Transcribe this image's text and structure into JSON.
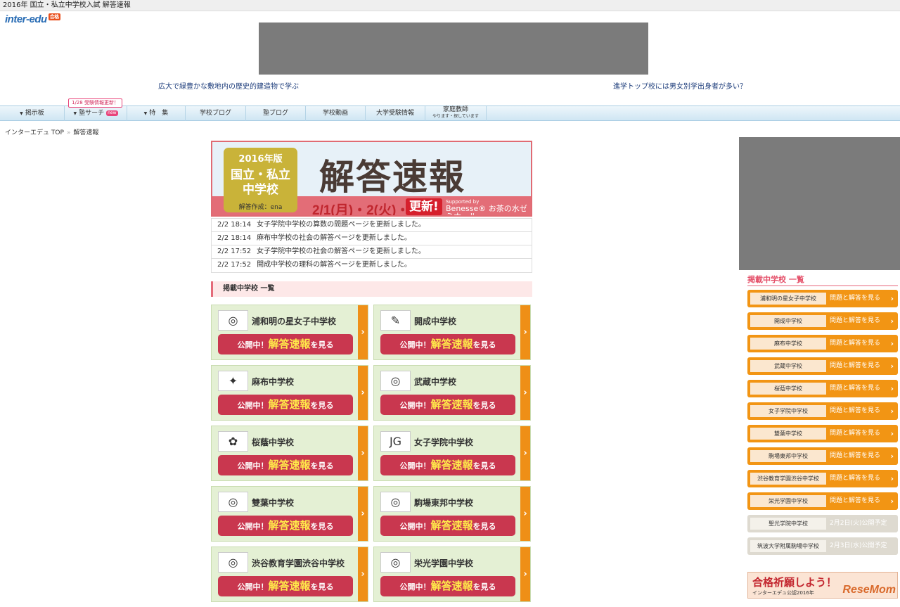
{
  "page_title": "2016年 国立・私立中学校入試 解答速報",
  "logo": {
    "text": "inter-edu",
    "badge": "合格"
  },
  "headlines": {
    "left": "広大で緑豊かな敷地内の歴史的建造物で学ぶ",
    "right": "進学トップ校には男女別学出身者が多い？"
  },
  "nav": {
    "callout": "1/28 受験情報更新！",
    "items": [
      "掲示板",
      "塾サーチ",
      "特　集",
      "学校ブログ",
      "塾ブログ",
      "学校動画",
      "大学受験情報",
      "家庭教師"
    ],
    "new_tag": "new",
    "tutor_sub": "やります・探しています"
  },
  "breadcrumb": {
    "home": "インターエデュ TOP",
    "sep": "»",
    "current": "解答速報"
  },
  "banner": {
    "year": "2016年版",
    "kind": "国立・私立\n中学校",
    "maker": "解答作成：ena",
    "title": "解答速報",
    "dates": "2/1(月)・2(火)・3(水)",
    "update": "更新!",
    "supported": "Supported by",
    "sponsor": "Benesse® お茶の水ゼミナール"
  },
  "news": [
    {
      "time": "2/2 18:14",
      "text": "女子学院中学校の算数の問題ページを更新しました。"
    },
    {
      "time": "2/2 18:14",
      "text": "麻布中学校の社会の解答ページを更新しました。"
    },
    {
      "time": "2/2 17:52",
      "text": "女子学院中学校の社会の解答ページを更新しました。"
    },
    {
      "time": "2/2 17:52",
      "text": "開成中学校の理科の解答ページを更新しました。"
    }
  ],
  "section_title": "掲載中学校 一覧",
  "card_button": {
    "pre": "公開中！",
    "hl": "解答速報",
    "post": "を見る"
  },
  "cards": [
    {
      "name": "浦和明の星女子中学校",
      "icon": "seal-icon"
    },
    {
      "name": "開成中学校",
      "icon": "pen-sword-icon"
    },
    {
      "name": "麻布中学校",
      "icon": "star-icon"
    },
    {
      "name": "武蔵中学校",
      "icon": "seal-icon"
    },
    {
      "name": "桜蔭中学校",
      "icon": "sakura-icon"
    },
    {
      "name": "女子学院中学校",
      "icon": "jg-icon"
    },
    {
      "name": "雙葉中学校",
      "icon": "seal-icon"
    },
    {
      "name": "駒場東邦中学校",
      "icon": "seal-icon"
    },
    {
      "name": "渋谷教育学園渋谷中学校",
      "icon": "seal-icon"
    },
    {
      "name": "栄光学園中学校",
      "icon": "seal-icon"
    }
  ],
  "side_list": {
    "title": "掲載中学校 一覧",
    "items": [
      {
        "name": "浦和明の星女子中学校",
        "action": "問題と解答を見る",
        "status": "open"
      },
      {
        "name": "開成中学校",
        "action": "問題と解答を見る",
        "status": "open"
      },
      {
        "name": "麻布中学校",
        "action": "問題と解答を見る",
        "status": "open"
      },
      {
        "name": "武蔵中学校",
        "action": "問題と解答を見る",
        "status": "open"
      },
      {
        "name": "桜蔭中学校",
        "action": "問題と解答を見る",
        "status": "open"
      },
      {
        "name": "女子学院中学校",
        "action": "問題と解答を見る",
        "status": "open"
      },
      {
        "name": "雙葉中学校",
        "action": "問題と解答を見る",
        "status": "open"
      },
      {
        "name": "駒場東邦中学校",
        "action": "問題と解答を見る",
        "status": "open"
      },
      {
        "name": "渋谷教育学園渋谷中学校",
        "action": "問題と解答を見る",
        "status": "open"
      },
      {
        "name": "栄光学園中学校",
        "action": "問題と解答を見る",
        "status": "open"
      },
      {
        "name": "聖光学院中学校",
        "action": "2月2日(火)公開予定",
        "status": "closed"
      },
      {
        "name": "筑波大学附属駒場中学校",
        "action": "2月3日(水)公開予定",
        "status": "closed"
      }
    ]
  },
  "side_banner": {
    "big": "合格祈願しよう！",
    "small": "インターエデュ公認2016年",
    "watermark": "ReseMom"
  }
}
